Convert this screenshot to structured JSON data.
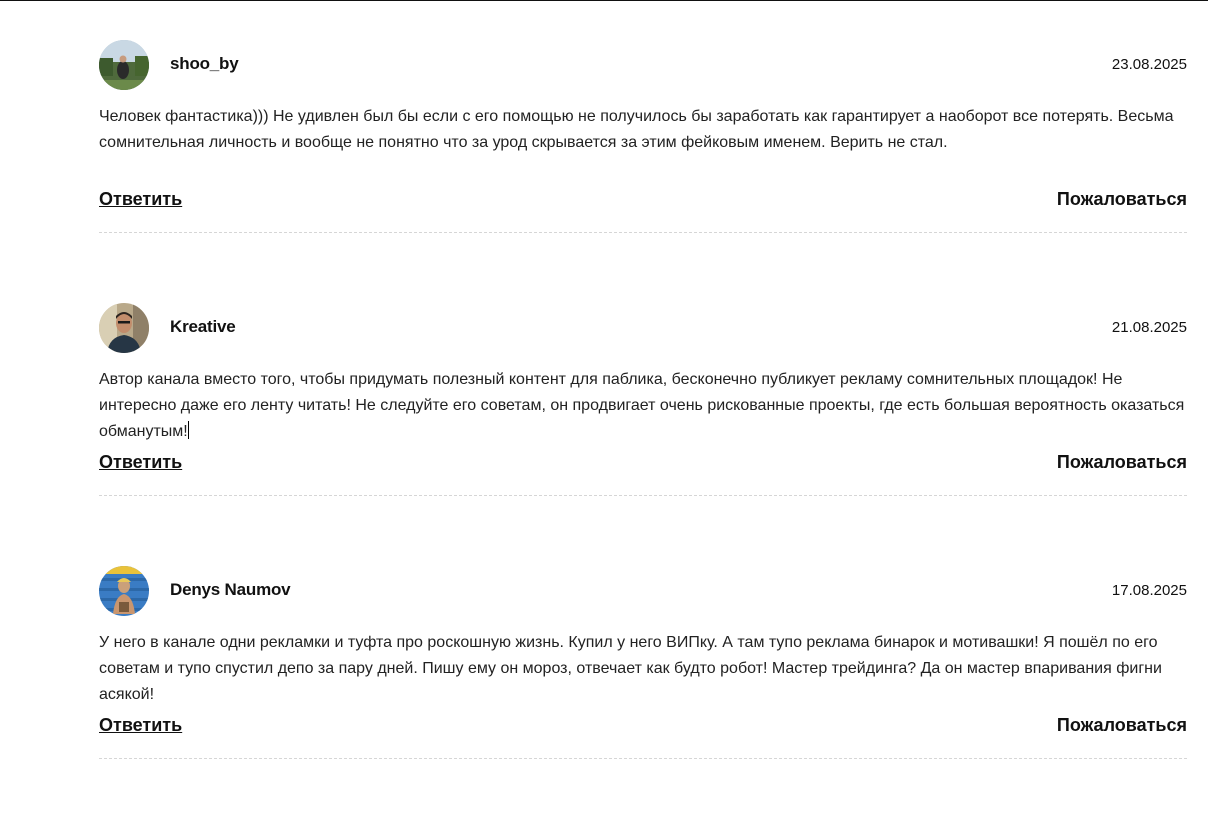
{
  "comments": [
    {
      "author": "shoo_by",
      "date": "23.08.2025",
      "text": "Человек фантастика))) Не удивлен был бы если с его помощью не получилось бы заработать как гарантирует а наоборот все потерять. Весьма сомнительная личность и вообще не понятно что за урод скрывается за этим фейковым именем. Верить не стал.",
      "reply_label": "Ответить",
      "report_label": "Пожаловаться"
    },
    {
      "author": "Kreative",
      "date": "21.08.2025",
      "text": "Автор канала вместо того, чтобы придумать полезный контент для паблика, бесконечно публикует рекламу сомнительных площадок! Не интересно даже его ленту читать! Не следуйте его советам, он продвигает очень рискованные проекты, где есть большая вероятность оказаться обманутым!",
      "reply_label": "Ответить",
      "report_label": "Пожаловаться"
    },
    {
      "author": "Denys Naumov",
      "date": "17.08.2025",
      "text": "У него в канале одни рекламки и туфта про роскошную жизнь. Купил у него ВИПку. А там тупо реклама бинарок и мотивашки! Я пошёл по его советам и тупо спустил депо за пару дней. Пишу ему он мороз, отвечает как будто робот! Мастер трейдинга? Да он мастер впаривания фигни асякой!",
      "reply_label": "Ответить",
      "report_label": "Пожаловаться"
    }
  ]
}
